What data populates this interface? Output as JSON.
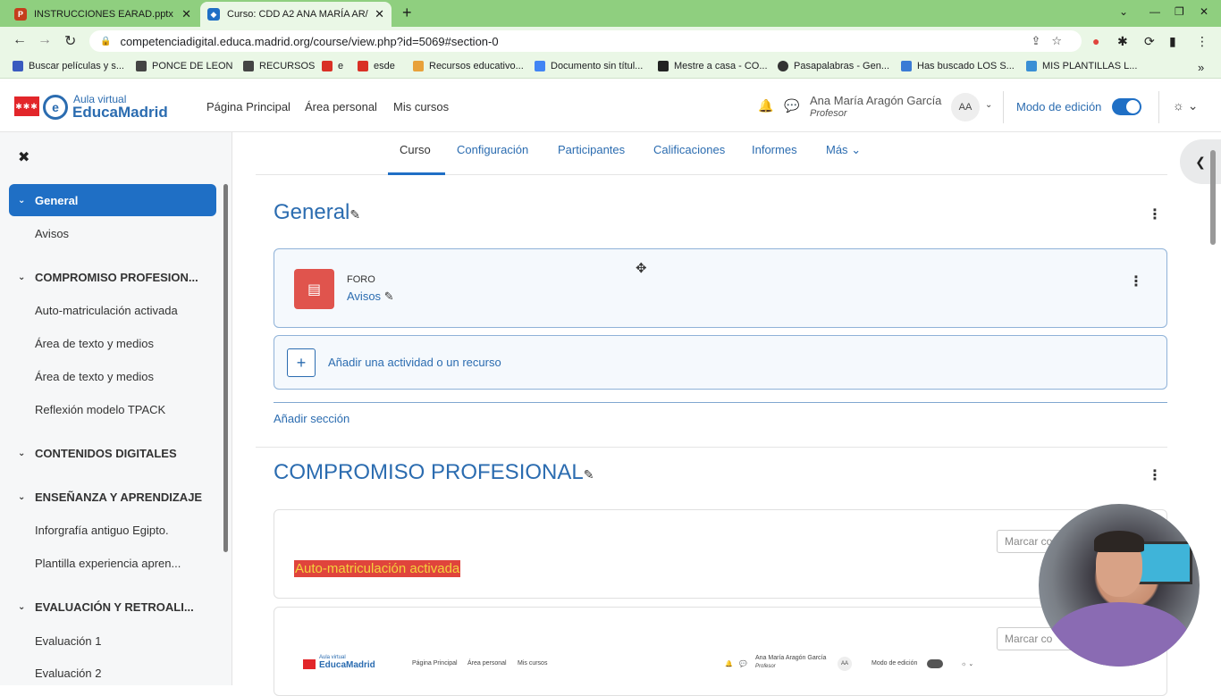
{
  "browser": {
    "tabs": [
      {
        "label": "INSTRUCCIONES EARAD.pptx",
        "icon": "powerpoint-icon"
      },
      {
        "label": "Curso: CDD A2 ANA MARÍA AR/",
        "icon": "moodle-icon"
      }
    ],
    "url": "competenciadigital.educa.madrid.org/course/view.php?id=5069#section-0",
    "bookmarks": [
      "Buscar películas y s...",
      "PONCE DE LEON",
      "RECURSOS",
      "e",
      "esde",
      "Recursos educativo...",
      "Documento sin títul...",
      "Mestre a casa - CO...",
      "Pasapalabras - Gen...",
      "Has buscado LOS S...",
      "MIS PLANTILLAS L..."
    ]
  },
  "header": {
    "logo_small": "Aula virtual",
    "logo_big": "EducaMadrid",
    "nav": [
      "Página Principal",
      "Área personal",
      "Mis cursos"
    ],
    "user_name": "Ana María Aragón García",
    "user_role": "Profesor",
    "avatar": "AA",
    "edit_mode_label": "Modo de edición"
  },
  "drawer": {
    "items": [
      {
        "label": "General",
        "type": "section",
        "active": true
      },
      {
        "label": "Avisos",
        "type": "item"
      },
      {
        "label": "COMPROMISO PROFESION...",
        "type": "section"
      },
      {
        "label": "Auto-matriculación activada",
        "type": "item"
      },
      {
        "label": "Área de texto y medios",
        "type": "item"
      },
      {
        "label": "Área de texto y medios",
        "type": "item"
      },
      {
        "label": "Reflexión modelo TPACK",
        "type": "item"
      },
      {
        "label": "CONTENIDOS DIGITALES",
        "type": "section"
      },
      {
        "label": "ENSEÑANZA Y APRENDIZAJE",
        "type": "section"
      },
      {
        "label": "Inforgrafía antiguo Egipto.",
        "type": "item"
      },
      {
        "label": "Plantilla experiencia apren...",
        "type": "item"
      },
      {
        "label": "EVALUACIÓN Y RETROALI...",
        "type": "section"
      },
      {
        "label": "Evaluación 1",
        "type": "item"
      },
      {
        "label": "Evaluación 2",
        "type": "item"
      }
    ]
  },
  "course_tabs": [
    "Curso",
    "Configuración",
    "Participantes",
    "Calificaciones",
    "Informes",
    "Más"
  ],
  "sections": {
    "general": {
      "title": "General",
      "forum_type": "FORO",
      "forum_name": "Avisos",
      "add_activity": "Añadir una actividad o un recurso",
      "add_section": "Añadir sección"
    },
    "compromiso": {
      "title": "COMPROMISO PROFESIONAL",
      "mark_label": "Marcar co",
      "activity_label": "Auto-matriculación activada",
      "embedded": {
        "logo_small": "Aula virtual",
        "logo_big": "EducaMadrid",
        "nav": [
          "Página Principal",
          "Área personal",
          "Mis cursos"
        ],
        "user_name": "Ana María Aragón García",
        "user_role": "Profesor",
        "avatar": "AA",
        "edit_mode_label": "Modo de edición"
      }
    }
  }
}
